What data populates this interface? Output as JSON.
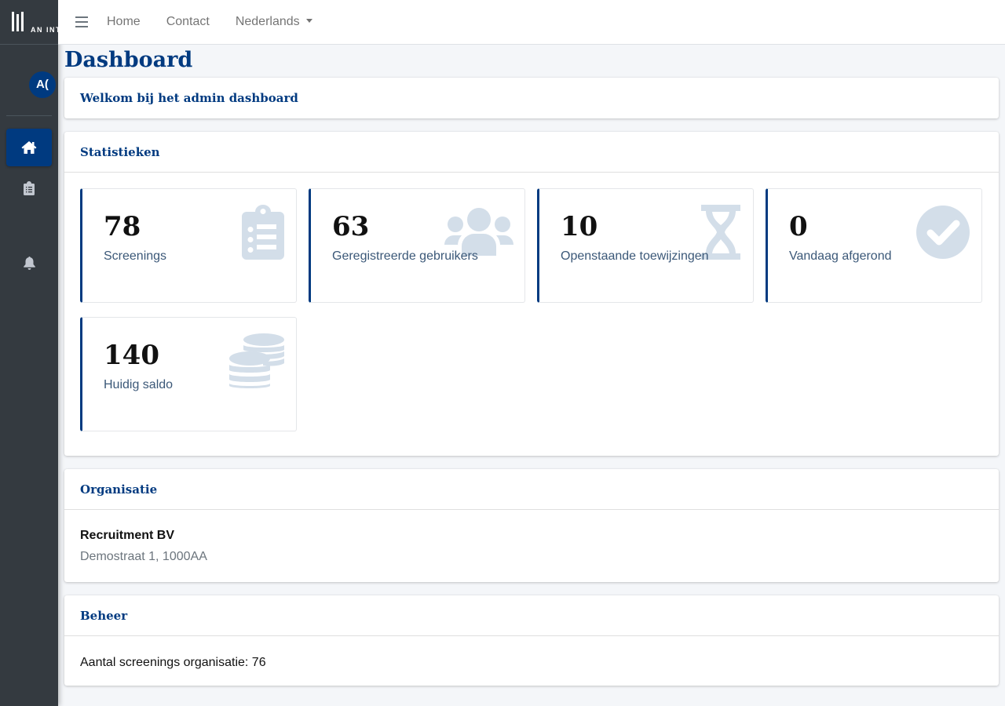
{
  "brand": {
    "text": "AN INT"
  },
  "user": {
    "initials": "A("
  },
  "sidebar": {
    "items": [
      {
        "name": "home",
        "icon": "home-icon",
        "active": true
      },
      {
        "name": "screenings",
        "icon": "clipboard-icon",
        "active": false
      },
      {
        "name": "notifications",
        "icon": "bell-icon",
        "active": false
      }
    ]
  },
  "navbar": {
    "home_label": "Home",
    "contact_label": "Contact",
    "language_label": "Nederlands"
  },
  "page": {
    "title": "Dashboard"
  },
  "welcome": {
    "title": "Welkom bij het admin dashboard"
  },
  "stats": {
    "title": "Statistieken",
    "items": [
      {
        "value": "78",
        "label": "Screenings",
        "icon": "clipboard-list-icon"
      },
      {
        "value": "63",
        "label": "Geregistreerde gebruikers",
        "icon": "users-icon"
      },
      {
        "value": "10",
        "label": "Openstaande toewijzingen",
        "icon": "hourglass-icon"
      },
      {
        "value": "0",
        "label": "Vandaag afgerond",
        "icon": "check-circle-icon"
      },
      {
        "value": "140",
        "label": "Huidig saldo",
        "icon": "coins-icon"
      }
    ]
  },
  "organisation": {
    "title": "Organisatie",
    "name": "Recruitment BV",
    "address": "Demostraat 1, 1000AA"
  },
  "management": {
    "title": "Beheer",
    "text": "Aantal screenings organisatie: 76"
  },
  "colors": {
    "primary": "#003a80",
    "sidebar": "#343a40",
    "icon_muted": "#d3dee9"
  }
}
